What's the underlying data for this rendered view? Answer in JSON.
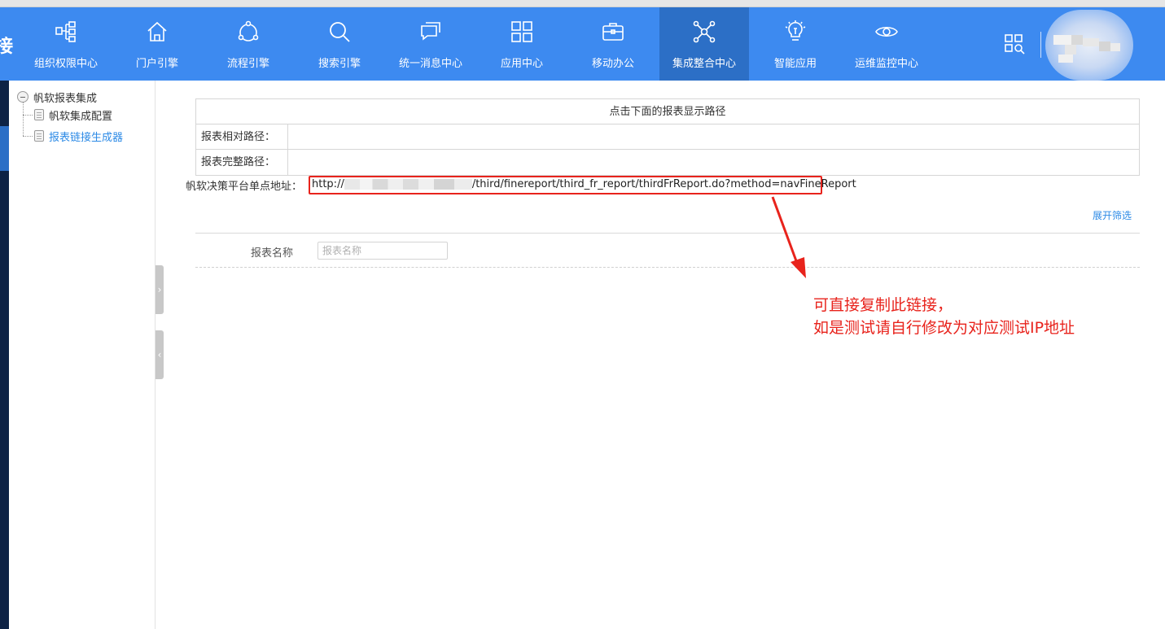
{
  "header": {
    "brand_partial": "接",
    "nav": [
      {
        "label": "组织权限中心",
        "icon": "org-chart-icon",
        "active": false
      },
      {
        "label": "门户引擎",
        "icon": "home-icon",
        "active": false
      },
      {
        "label": "流程引擎",
        "icon": "process-cycle-icon",
        "active": false
      },
      {
        "label": "搜索引擎",
        "icon": "search-icon",
        "active": false
      },
      {
        "label": "统一消息中心",
        "icon": "message-icon",
        "active": false
      },
      {
        "label": "应用中心",
        "icon": "grid-icon",
        "active": false
      },
      {
        "label": "移动办公",
        "icon": "briefcase-icon",
        "active": false
      },
      {
        "label": "集成整合中心",
        "icon": "network-nodes-icon",
        "active": true
      },
      {
        "label": "智能应用",
        "icon": "lightbulb-icon",
        "active": false
      },
      {
        "label": "运维监控中心",
        "icon": "eye-icon",
        "active": false
      }
    ],
    "apps_icon": "apps-search-icon",
    "accent_color": "#3d8af0",
    "active_color": "#2c6fc6"
  },
  "tree": {
    "root": "帆软报表集成",
    "children": [
      {
        "label": "帆软集成配置",
        "selected": false
      },
      {
        "label": "报表链接生成器",
        "selected": true
      }
    ]
  },
  "path_panel": {
    "title": "点击下面的报表显示路径",
    "relative_label": "报表相对路径：",
    "relative_value": "",
    "full_label": "报表完整路径：",
    "full_value": ""
  },
  "sso": {
    "label": "帆软决策平台单点地址：",
    "url_prefix": "http://",
    "url_suffix": "/third/finereport/third_fr_report/thirdFrReport.do?method=navFineReport"
  },
  "filter": {
    "expand_link": "展开筛选",
    "name_label": "报表名称",
    "name_placeholder": "报表名称",
    "name_value": ""
  },
  "annotation": {
    "line1": "可直接复制此链接，",
    "line2": "如是测试请自行修改为对应测试IP地址",
    "color": "#e8231c"
  }
}
